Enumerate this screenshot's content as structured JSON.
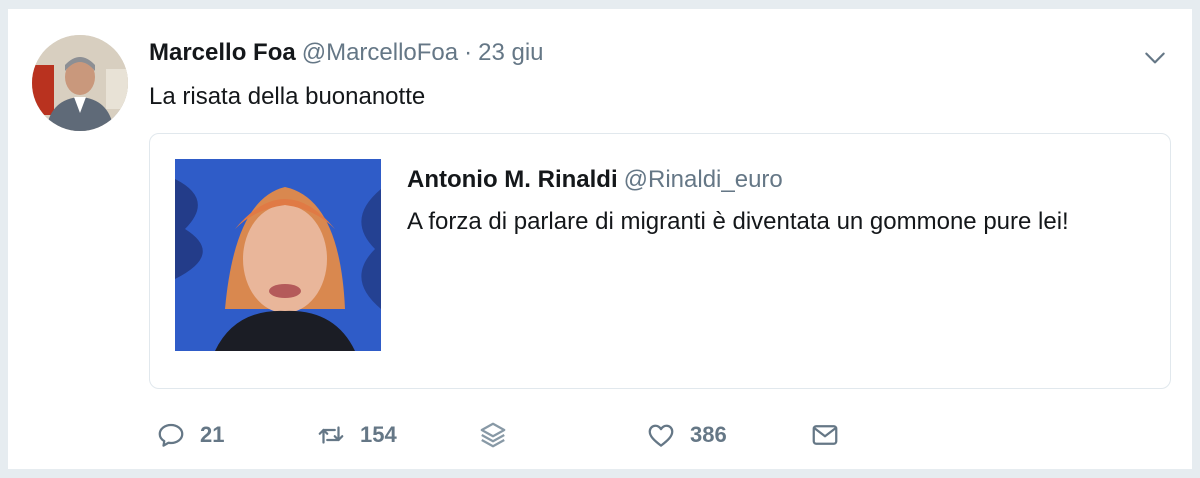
{
  "tweet": {
    "author_name": "Marcello Foa",
    "author_handle": "@MarcelloFoa",
    "separator": "·",
    "time": "23 giu",
    "text": "La risata della buonanotte",
    "avatar_icon": "user-photo",
    "menu_icon": "chevron-down-icon"
  },
  "quote": {
    "author_name": "Antonio M. Rinaldi",
    "author_handle": "@Rinaldi_euro",
    "text": "A forza di parlare di migranti è diventata un gommone pure lei!",
    "image_icon": "media-thumbnail"
  },
  "actions": {
    "reply_count": "21",
    "retweet_count": "154",
    "like_count": "386",
    "icons": [
      "reply-icon",
      "retweet-icon",
      "layers-icon",
      "heart-icon",
      "envelope-icon"
    ]
  },
  "colors": {
    "text": "#14171a",
    "secondary": "#657786",
    "border": "#e1e8ed",
    "background": "#e6ecf0"
  }
}
